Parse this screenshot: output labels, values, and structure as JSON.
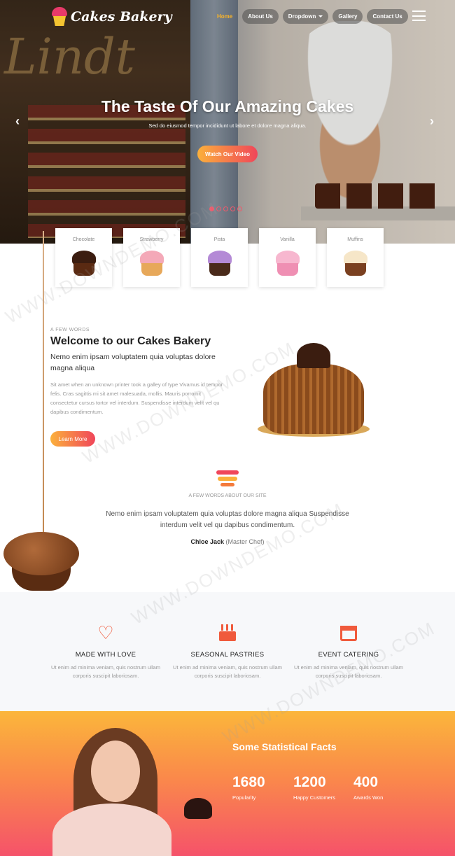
{
  "brand": {
    "name": "Cakes Bakery"
  },
  "nav": {
    "items": [
      {
        "label": "Home",
        "active": true
      },
      {
        "label": "About Us"
      },
      {
        "label": "Dropdown"
      },
      {
        "label": "Gallery"
      },
      {
        "label": "Contact Us"
      }
    ]
  },
  "hero": {
    "title": "The Taste Of Our Amazing Cakes",
    "subtitle": "Sed do eiusmod tempor incididunt ut labore et dolore magna aliqua.",
    "button": "Watch Our Video",
    "background_sign": "Lindt",
    "slides": 5
  },
  "products": [
    {
      "label": "Chocolate",
      "top": "#3b1d10",
      "bottom": "#5a2a12"
    },
    {
      "label": "Strawberry",
      "top": "#f4a9b8",
      "bottom": "#e7a85a"
    },
    {
      "label": "Pista",
      "top": "#b48ad6",
      "bottom": "#4a2a1a"
    },
    {
      "label": "Vanilla",
      "top": "#f7b7cf",
      "bottom": "#ef8fb3"
    },
    {
      "label": "Muffins",
      "top": "#f6e6c8",
      "bottom": "#7a4020"
    }
  ],
  "welcome": {
    "kicker": "A FEW WORDS",
    "title": "Welcome to our Cakes Bakery",
    "lead": "Nemo enim ipsam voluptatem quia voluptas dolore magna aliqua",
    "body": "Sit amet when an unknown printer took a galley of type Vivamus id tempor felis. Cras sagittis mi sit amet malesuada, mollis. Mauris porroinit consectetur cursus tortor vel interdum. Suspendisse interdum velit vel qu dapibus condimentum.",
    "button": "Learn More"
  },
  "quote": {
    "kicker": "A FEW WORDS ABOUT OUR SITE",
    "text": "Nemo enim ipsam voluptatem quia voluptas dolore magna aliqua Suspendisse interdum velit vel qu dapibus condimentum.",
    "author": "Chloe Jack",
    "role": "(Master Chef)"
  },
  "features": [
    {
      "icon": "heart-icon",
      "title": "MADE WITH LOVE",
      "desc": "Ut enim ad minima veniam, quis nostrum ullam corporis suscipit laboriosam."
    },
    {
      "icon": "cake-icon",
      "title": "SEASONAL PASTRIES",
      "desc": "Ut enim ad minima veniam, quis nostrum ullam corporis suscipit laboriosam."
    },
    {
      "icon": "calendar-icon",
      "title": "EVENT CATERING",
      "desc": "Ut enim ad minima veniam, quis nostrum ullam corporis suscipit laboriosam."
    }
  ],
  "stats": {
    "title": "Some Statistical Facts",
    "items": [
      {
        "value": "1680",
        "label": "Popularity"
      },
      {
        "value": "1200",
        "label": "Happy Customers"
      },
      {
        "value": "400",
        "label": "Awards Won"
      }
    ]
  },
  "watermark": "WWW.DOWNDEMO.COM",
  "colors": {
    "accent_start": "#fbb03b",
    "accent_end": "#f0465a",
    "active_nav": "#f7b32b"
  }
}
